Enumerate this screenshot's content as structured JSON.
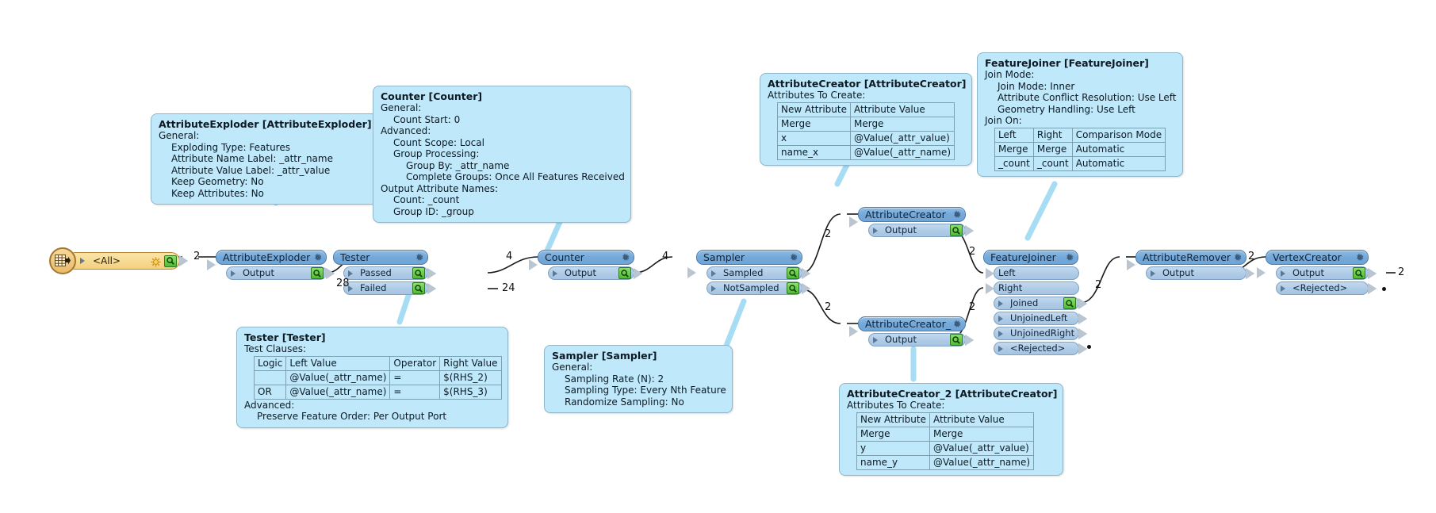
{
  "canvas": {
    "background": "#ffffff",
    "node_header_color": "#74a9da",
    "port_color": "#aecbe6",
    "annotation_color": "#bfe8fb",
    "reader_color": "#f3d180",
    "connector_color": "#1a1a1a"
  },
  "reader": {
    "label": "<All>",
    "icon": "table-reader-icon",
    "sun_icon": "sun-icon",
    "inspect_icon": "magnifier-icon"
  },
  "nodes": [
    {
      "id": "attributeexploder",
      "title": "AttributeExploder",
      "ports": [
        {
          "name": "Output",
          "inspect": true
        }
      ]
    },
    {
      "id": "tester",
      "title": "Tester",
      "ports": [
        {
          "name": "Passed",
          "inspect": true
        },
        {
          "name": "Failed",
          "inspect": true
        }
      ]
    },
    {
      "id": "counter",
      "title": "Counter",
      "ports": [
        {
          "name": "Output",
          "inspect": true
        }
      ]
    },
    {
      "id": "sampler",
      "title": "Sampler",
      "ports": [
        {
          "name": "Sampled",
          "inspect": true
        },
        {
          "name": "NotSampled",
          "inspect": true
        }
      ]
    },
    {
      "id": "attributecreator",
      "title": "AttributeCreator",
      "ports": [
        {
          "name": "Output",
          "inspect": true
        }
      ]
    },
    {
      "id": "attributecreator_2",
      "title": "AttributeCreator_2",
      "ports": [
        {
          "name": "Output",
          "inspect": true
        }
      ]
    },
    {
      "id": "featurejoiner",
      "title": "FeatureJoiner",
      "ports": [
        {
          "name": "Left",
          "inspect": false,
          "input": true
        },
        {
          "name": "Right",
          "inspect": false,
          "input": true
        },
        {
          "name": "Joined",
          "inspect": true
        },
        {
          "name": "UnjoinedLeft",
          "inspect": false
        },
        {
          "name": "UnjoinedRight",
          "inspect": false
        },
        {
          "name": "<Rejected>",
          "inspect": false
        }
      ]
    },
    {
      "id": "attributeremover",
      "title": "AttributeRemover",
      "ports": [
        {
          "name": "Output",
          "inspect": false
        }
      ]
    },
    {
      "id": "vertexcreator",
      "title": "VertexCreator",
      "ports": [
        {
          "name": "Output",
          "inspect": true
        },
        {
          "name": "<Rejected>",
          "inspect": false
        }
      ]
    }
  ],
  "edge_labels": [
    {
      "id": "reader-to-exploder",
      "value": "2"
    },
    {
      "id": "exploder-to-tester",
      "value": "28"
    },
    {
      "id": "tester-passed-to-counter",
      "value": "4"
    },
    {
      "id": "tester-failed",
      "value": "24"
    },
    {
      "id": "counter-to-sampler",
      "value": "4"
    },
    {
      "id": "sampler-sampled-to-ac1",
      "value": "2"
    },
    {
      "id": "sampler-notsampled-to-ac2",
      "value": "2"
    },
    {
      "id": "ac1-to-featurejoiner-left",
      "value": "2"
    },
    {
      "id": "ac2-to-featurejoiner-right",
      "value": "2"
    },
    {
      "id": "joined-to-attributeremover",
      "value": "2"
    },
    {
      "id": "remover-to-vertexcreator",
      "value": "2"
    },
    {
      "id": "vertexcreator-output",
      "value": "2"
    }
  ],
  "annotations": {
    "attributeexploder": {
      "title": "AttributeExploder [AttributeExploder]",
      "lines": [
        {
          "indent": 0,
          "text": "General:"
        },
        {
          "indent": 1,
          "text": "Exploding Type: Features"
        },
        {
          "indent": 1,
          "text": "Attribute Name Label: _attr_name"
        },
        {
          "indent": 1,
          "text": "Attribute Value Label: _attr_value"
        },
        {
          "indent": 1,
          "text": "Keep Geometry: No"
        },
        {
          "indent": 1,
          "text": "Keep Attributes: No"
        }
      ]
    },
    "counter": {
      "title": "Counter [Counter]",
      "lines": [
        {
          "indent": 0,
          "text": "General:"
        },
        {
          "indent": 1,
          "text": "Count Start: 0"
        },
        {
          "indent": 0,
          "text": "Advanced:"
        },
        {
          "indent": 1,
          "text": "Count Scope: Local"
        },
        {
          "indent": 1,
          "text": "Group Processing:"
        },
        {
          "indent": 2,
          "text": "Group By: _attr_name"
        },
        {
          "indent": 2,
          "text": "Complete Groups: Once All Features Received"
        },
        {
          "indent": 0,
          "text": "Output Attribute Names:"
        },
        {
          "indent": 1,
          "text": "Count: _count"
        },
        {
          "indent": 1,
          "text": "Group ID: _group"
        }
      ]
    },
    "tester": {
      "title": "Tester [Tester]",
      "lines_before": [
        {
          "indent": 0,
          "text": "Test Clauses:"
        }
      ],
      "table": {
        "headers": [
          "Logic",
          "Left Value",
          "Operator",
          "Right Value"
        ],
        "rows": [
          [
            "",
            "@Value(_attr_name)",
            "=",
            "$(RHS_2)"
          ],
          [
            "OR",
            "@Value(_attr_name)",
            "=",
            "$(RHS_3)"
          ]
        ]
      },
      "lines_after": [
        {
          "indent": 0,
          "text": "Advanced:"
        },
        {
          "indent": 1,
          "text": "Preserve Feature Order: Per Output Port"
        }
      ]
    },
    "sampler": {
      "title": "Sampler [Sampler]",
      "lines": [
        {
          "indent": 0,
          "text": "General:"
        },
        {
          "indent": 1,
          "text": "Sampling Rate (N): 2"
        },
        {
          "indent": 1,
          "text": "Sampling Type: Every Nth Feature"
        },
        {
          "indent": 1,
          "text": "Randomize Sampling: No"
        }
      ]
    },
    "attributecreator": {
      "title": "AttributeCreator [AttributeCreator]",
      "lines_before": [
        {
          "indent": 0,
          "text": "Attributes To Create:"
        }
      ],
      "table": {
        "headers": [
          "New Attribute",
          "Attribute Value"
        ],
        "rows": [
          [
            "Merge",
            "Merge"
          ],
          [
            "x",
            "@Value(_attr_value)"
          ],
          [
            "name_x",
            "@Value(_attr_name)"
          ]
        ]
      }
    },
    "attributecreator_2": {
      "title": "AttributeCreator_2 [AttributeCreator]",
      "lines_before": [
        {
          "indent": 0,
          "text": "Attributes To Create:"
        }
      ],
      "table": {
        "headers": [
          "New Attribute",
          "Attribute Value"
        ],
        "rows": [
          [
            "Merge",
            "Merge"
          ],
          [
            "y",
            "@Value(_attr_value)"
          ],
          [
            "name_y",
            "@Value(_attr_name)"
          ]
        ]
      }
    },
    "featurejoiner": {
      "title": "FeatureJoiner [FeatureJoiner]",
      "lines_before": [
        {
          "indent": 0,
          "text": "Join Mode:"
        },
        {
          "indent": 1,
          "text": "Join Mode: Inner"
        },
        {
          "indent": 1,
          "text": "Attribute Conflict Resolution: Use Left"
        },
        {
          "indent": 1,
          "text": "Geometry Handling: Use Left"
        },
        {
          "indent": 0,
          "text": "Join On:"
        }
      ],
      "table": {
        "headers": [
          "Left",
          "Right",
          "Comparison Mode"
        ],
        "rows": [
          [
            "Merge",
            "Merge",
            "Automatic"
          ],
          [
            "_count",
            "_count",
            "Automatic"
          ]
        ]
      }
    }
  }
}
